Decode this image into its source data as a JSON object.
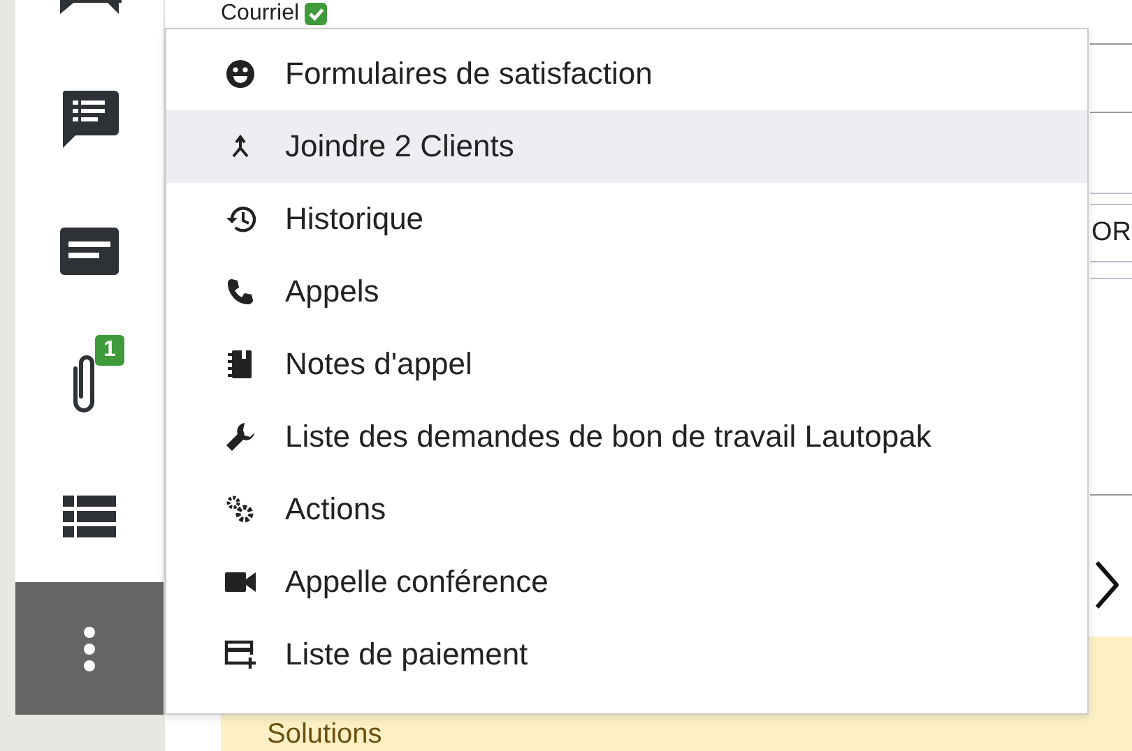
{
  "sidebar": {
    "items": [
      {
        "selected": false
      },
      {
        "selected": false
      },
      {
        "selected": false
      },
      {
        "selected": false,
        "badge": "1"
      },
      {
        "selected": false
      },
      {
        "selected": true
      }
    ]
  },
  "background": {
    "contact_label": "Courriel",
    "contact_verified": true,
    "cut_text": "OR",
    "panel_title": "Solutions"
  },
  "menu": {
    "items": [
      {
        "label": "Formulaires de satisfaction",
        "selected": false
      },
      {
        "label": "Joindre 2 Clients",
        "selected": true
      },
      {
        "label": "Historique",
        "selected": false
      },
      {
        "label": "Appels",
        "selected": false
      },
      {
        "label": "Notes d'appel",
        "selected": false
      },
      {
        "label": "Liste des demandes de bon de travail Lautopak",
        "selected": false
      },
      {
        "label": "Actions",
        "selected": false
      },
      {
        "label": "Appelle conférence",
        "selected": false
      },
      {
        "label": "Liste de paiement",
        "selected": false
      }
    ]
  }
}
